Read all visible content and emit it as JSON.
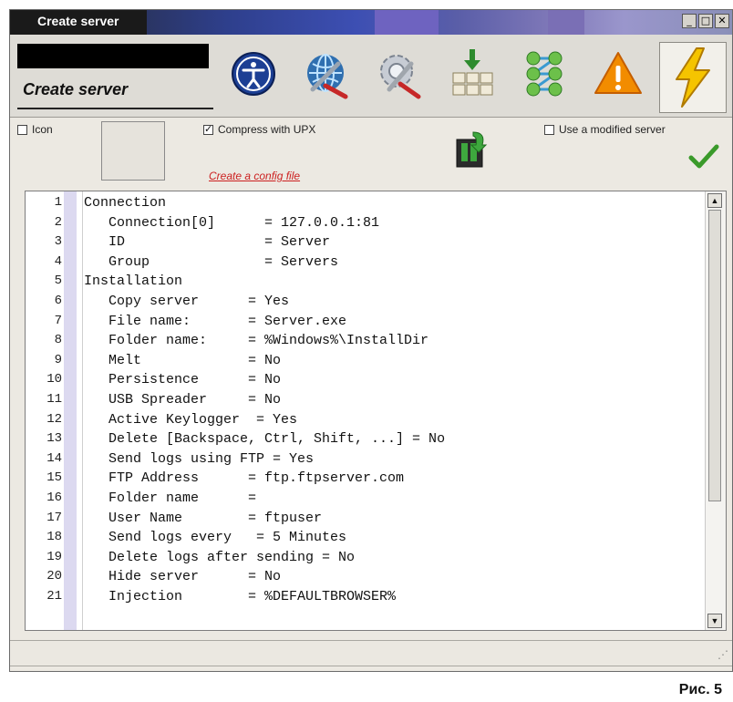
{
  "window": {
    "title": "Create server"
  },
  "toolbar": {
    "heading": "Create server",
    "tools": [
      {
        "name": "accessibility-tool",
        "icon": "person-circle-icon"
      },
      {
        "name": "network-tool",
        "icon": "globe-wrench-icon"
      },
      {
        "name": "settings-tool",
        "icon": "gear-wrench-icon"
      },
      {
        "name": "install-tool",
        "icon": "download-grid-icon"
      },
      {
        "name": "modules-tool",
        "icon": "green-nodes-icon"
      },
      {
        "name": "warning-tool",
        "icon": "warning-triangle-icon"
      },
      {
        "name": "create-tool",
        "icon": "lightning-icon"
      }
    ]
  },
  "options": {
    "icon_label": "Icon",
    "icon_checked": false,
    "compress_label": "Compress with UPX",
    "compress_checked": true,
    "config_link": "Create a config file",
    "modified_label": "Use a modified server",
    "modified_checked": false
  },
  "config_lines": [
    {
      "num": "1",
      "text": "Connection"
    },
    {
      "num": "2",
      "text": "   Connection[0]      = 127.0.0.1:81"
    },
    {
      "num": "3",
      "text": "   ID                 = Server"
    },
    {
      "num": "4",
      "text": "   Group              = Servers"
    },
    {
      "num": "5",
      "text": "Installation"
    },
    {
      "num": "6",
      "text": "   Copy server      = Yes"
    },
    {
      "num": "7",
      "text": "   File name:       = Server.exe"
    },
    {
      "num": "8",
      "text": "   Folder name:     = %Windows%\\InstallDir"
    },
    {
      "num": "9",
      "text": "   Melt             = No"
    },
    {
      "num": "10",
      "text": "   Persistence      = No"
    },
    {
      "num": "11",
      "text": "   USB Spreader     = No"
    },
    {
      "num": "12",
      "text": "   Active Keylogger  = Yes"
    },
    {
      "num": "13",
      "text": "   Delete [Backspace, Ctrl, Shift, ...] = No"
    },
    {
      "num": "14",
      "text": "   Send logs using FTP = Yes"
    },
    {
      "num": "15",
      "text": "   FTP Address      = ftp.ftpserver.com"
    },
    {
      "num": "16",
      "text": "   Folder name      ="
    },
    {
      "num": "17",
      "text": "   User Name        = ftpuser"
    },
    {
      "num": "18",
      "text": "   Send logs every   = 5 Minutes"
    },
    {
      "num": "19",
      "text": "   Delete logs after sending = No"
    },
    {
      "num": "20",
      "text": "   Hide server      = No"
    },
    {
      "num": "21",
      "text": "   Injection        = %DEFAULTBROWSER%"
    }
  ],
  "caption": "Рис. 5",
  "colors": {
    "link": "#cc1f1f",
    "check_green": "#3a9a2a",
    "gutter_strip": "#dcd9f0"
  }
}
